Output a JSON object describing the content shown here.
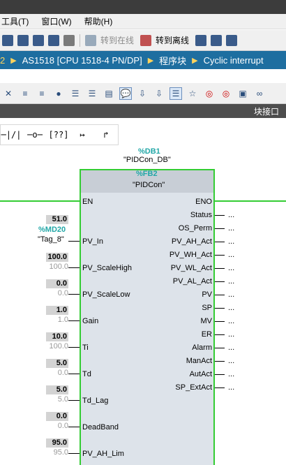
{
  "menu": {
    "tools": "工具(T)",
    "window": "窗口(W)",
    "help": "帮助(H)"
  },
  "toolbar": {
    "go_online": "转到在线",
    "go_offline": "转到离线"
  },
  "breadcrumb": {
    "prefix": "2",
    "items": [
      "AS1518 [CPU 1518-4 PN/DP]",
      "程序块",
      "Cyclic interrupt"
    ]
  },
  "panel": {
    "title": "块接口"
  },
  "block": {
    "db_number": "%DB1",
    "db_name": "\"PIDCon_DB\"",
    "fb_number": "%FB2",
    "fb_name": "\"PIDCon\""
  },
  "inputs": [
    {
      "label": "EN"
    },
    {
      "label": "PV_In",
      "value": "51.0",
      "addr": "%MD20",
      "tag": "\"Tag_8\""
    },
    {
      "label": "PV_ScaleHigh",
      "value": "100.0",
      "default": "100.0"
    },
    {
      "label": "PV_ScaleLow",
      "value": "0.0",
      "default": "0.0"
    },
    {
      "label": "Gain",
      "value": "1.0",
      "default": "1.0"
    },
    {
      "label": "Ti",
      "value": "10.0",
      "default": "100.0"
    },
    {
      "label": "Td",
      "value": "5.0",
      "default": "0.0"
    },
    {
      "label": "Td_Lag",
      "value": "5.0",
      "default": "5.0"
    },
    {
      "label": "DeadBand",
      "value": "0.0",
      "default": "0.0"
    },
    {
      "label": "PV_AH_Lim",
      "value": "95.0",
      "default": "95.0"
    }
  ],
  "outputs": [
    "ENO",
    "Status",
    "OS_Perm",
    "PV_AH_Act",
    "PV_WH_Act",
    "PV_WL_Act",
    "PV_AL_Act",
    "PV",
    "SP",
    "MV",
    "ER",
    "Alarm",
    "ManAct",
    "AutAct",
    "SP_ExtAct"
  ],
  "output_placeholder": "..."
}
